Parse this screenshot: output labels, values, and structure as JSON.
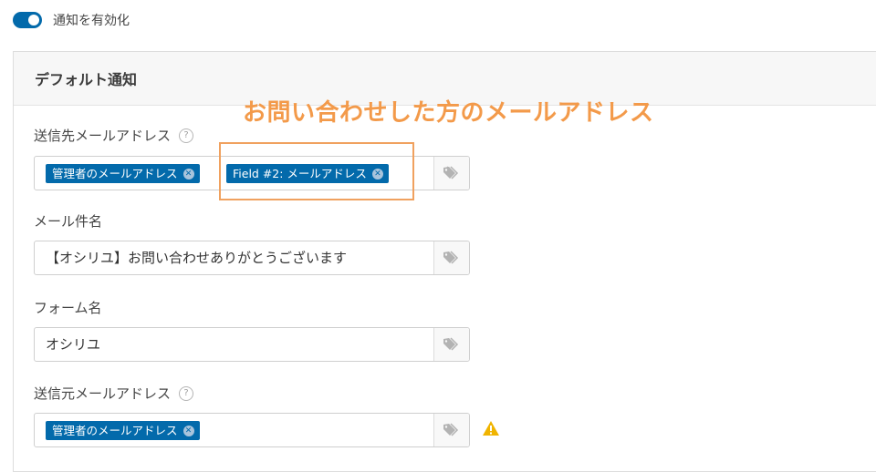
{
  "toggle": {
    "label": "通知を有効化"
  },
  "panel": {
    "title": "デフォルト通知"
  },
  "annotation": "お問い合わせした方のメールアドレス",
  "fields": {
    "send_to": {
      "label": "送信先メールアドレス",
      "help": "?",
      "chips": [
        "管理者のメールアドレス",
        "Field #2: メールアドレス"
      ]
    },
    "subject": {
      "label": "メール件名",
      "value": "【オシリユ】お問い合わせありがとうございます"
    },
    "from_name": {
      "label": "フォーム名",
      "value": "オシリユ"
    },
    "from_email": {
      "label": "送信元メールアドレス",
      "help": "?",
      "chips": [
        "管理者のメールアドレス"
      ]
    }
  },
  "chip_remove_glyph": "✕",
  "icons": {
    "tag": "tag-icon",
    "warning": "warning-icon",
    "help": "question-circle-icon"
  },
  "colors": {
    "accent": "#036aab",
    "annotation": "#f39a4a",
    "warning": "#f0b400"
  }
}
